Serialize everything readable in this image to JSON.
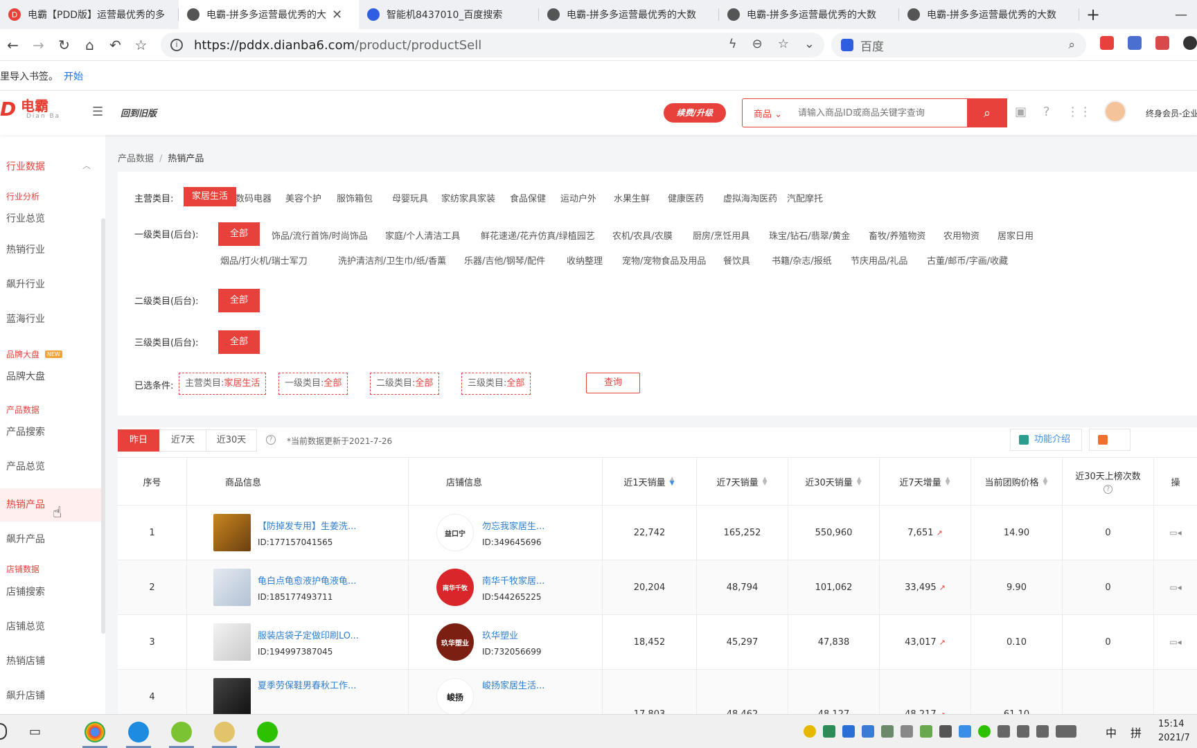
{
  "browser": {
    "tabs": [
      {
        "title": "电霸【PDD版】运营最优秀的多",
        "active": false
      },
      {
        "title": "电霸-拼多多运营最优秀的大",
        "active": true
      },
      {
        "title": "智能机8437010_百度搜索",
        "active": false
      },
      {
        "title": "电霸-拼多多运营最优秀的大数",
        "active": false
      },
      {
        "title": "电霸-拼多多运营最优秀的大数",
        "active": false
      },
      {
        "title": "电霸-拼多多运营最优秀的大数",
        "active": false
      }
    ],
    "new_tab": "+",
    "url_host": "https://pddx.dianba6.com",
    "url_path": "/product/productSell",
    "search_engine": "百度",
    "bookmark_hint": "里导入书签。",
    "bookmark_link": "开始"
  },
  "header": {
    "logo_name": "电霸",
    "logo_sub": "Dian Ba",
    "old_version": "回到旧版",
    "upgrade": "续费/升级",
    "search_scope": "商品",
    "search_placeholder": "请输入商品ID或商品关键字查询",
    "member": "终身会员-企业"
  },
  "sidebar": {
    "group": "行业数据",
    "sections": {
      "industry_analysis": "行业分析",
      "brand": "品牌大盘",
      "product_data": "产品数据",
      "shop_data": "店铺数据"
    },
    "new_badge": "NEW",
    "items": {
      "industry_overview": "行业总览",
      "hot_industry": "热销行业",
      "rising_industry": "飙升行业",
      "blue_sea": "蓝海行业",
      "brand_board": "品牌大盘",
      "product_search": "产品搜索",
      "product_overview": "产品总览",
      "hot_product": "热销产品",
      "rising_product": "飙升产品",
      "shop_search": "店铺搜索",
      "shop_overview": "店铺总览",
      "hot_shop": "热销店铺",
      "rising_shop": "飙升店铺"
    }
  },
  "breadcrumb": {
    "parent": "产品数据",
    "current": "热销产品"
  },
  "filters": {
    "main_label": "主营类目:",
    "main_categories": [
      "家居生活",
      "数码电器",
      "美容个护",
      "服饰箱包",
      "母婴玩具",
      "家纺家具家装",
      "食品保健",
      "运动户外",
      "水果生鲜",
      "健康医药",
      "虚拟海淘医药",
      "汽配摩托"
    ],
    "level1_label": "一级类目(后台):",
    "level1_all": "全部",
    "level1_row1": [
      "饰品/流行首饰/时尚饰品",
      "家庭/个人清洁工具",
      "鲜花速递/花卉仿真/绿植园艺",
      "农机/农具/农膜",
      "厨房/烹饪用具",
      "珠宝/钻石/翡翠/黄金",
      "畜牧/养殖物资",
      "农用物资",
      "居家日用"
    ],
    "level1_row2": [
      "烟品/打火机/瑞士军刀",
      "洗护清洁剂/卫生巾/纸/香薰",
      "乐器/吉他/钢琴/配件",
      "收纳整理",
      "宠物/宠物食品及用品",
      "餐饮具",
      "书籍/杂志/报纸",
      "节庆用品/礼品",
      "古董/邮币/字画/收藏"
    ],
    "level2_label": "二级类目(后台):",
    "level3_label": "三级类目(后台):",
    "all": "全部",
    "selected_label": "已选条件:",
    "conditions": [
      {
        "k": "主营类目:",
        "v": "家居生活"
      },
      {
        "k": "一级类目:",
        "v": "全部"
      },
      {
        "k": "二级类目:",
        "v": "全部"
      },
      {
        "k": "三级类目:",
        "v": "全部"
      }
    ],
    "query": "查询"
  },
  "table": {
    "periods": [
      "昨日",
      "近7天",
      "近30天"
    ],
    "update_note": "*当前数据更新于2021-7-26",
    "feature_intro": "功能介绍",
    "columns": [
      "序号",
      "商品信息",
      "店铺信息",
      "近1天销量",
      "近7天销量",
      "近30天销量",
      "近7天增量",
      "当前团购价格",
      "近30天上榜次数",
      "操"
    ],
    "rows": [
      {
        "no": "1",
        "name": "【防掉发专用】生姜洗...",
        "id": "ID:177157041565",
        "shop": "勿忘我家居生...",
        "shop_id": "ID:349645696",
        "shop_logo": "益口宁",
        "d1": "22,742",
        "d7": "165,252",
        "d30": "550,960",
        "inc7": "7,651",
        "price": "14.90",
        "rank": "0"
      },
      {
        "no": "2",
        "name": "龟白点龟愈液护龟液龟...",
        "id": "ID:185177493711",
        "shop": "南华千牧家居...",
        "shop_id": "ID:544265225",
        "shop_logo": "南华千牧",
        "d1": "20,204",
        "d7": "48,794",
        "d30": "101,062",
        "inc7": "33,495",
        "price": "9.90",
        "rank": "0"
      },
      {
        "no": "3",
        "name": "服装店袋子定做印刷LO...",
        "id": "ID:194997387045",
        "shop": "玖华塑业",
        "shop_id": "ID:732056699",
        "shop_logo": "玖华塑业",
        "d1": "18,452",
        "d7": "45,297",
        "d30": "47,838",
        "inc7": "43,017",
        "price": "0.10",
        "rank": "0"
      },
      {
        "no": "4",
        "name": "夏季劳保鞋男春秋工作...",
        "id": "",
        "shop": "峻扬家居生活...",
        "shop_id": "",
        "shop_logo": "峻扬",
        "d1": "17,803",
        "d7": "48,462",
        "d30": "48,127",
        "inc7": "48,217",
        "price": "61.10",
        "rank": ""
      }
    ]
  },
  "taskbar": {
    "ime": "中",
    "ime2": "拼",
    "time": "15:14",
    "date": "2021/7"
  },
  "colors": {
    "accent": "#e8403a",
    "link": "#2f7fd3"
  }
}
